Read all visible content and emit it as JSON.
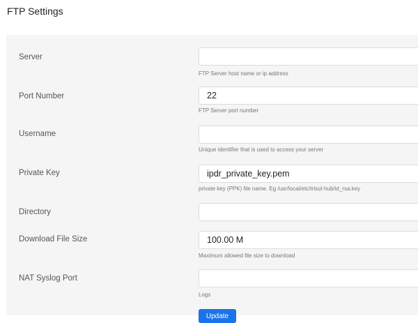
{
  "page": {
    "title": "FTP Settings"
  },
  "form": {
    "fields": [
      {
        "label": "Server",
        "value": "",
        "help": "FTP Server host name or ip address"
      },
      {
        "label": "Port Number",
        "value": "22",
        "help": "FTP Server port number"
      },
      {
        "label": "Username",
        "value": "",
        "help": "Unique identifier that is used to access your server"
      },
      {
        "label": "Private Key",
        "value": "ipdr_private_key.pem",
        "help": "private key (PPK) file name. Eg /usr/local/etc/trisul-hub/id_rsa.key"
      },
      {
        "label": "Directory",
        "value": "",
        "help": ""
      },
      {
        "label": "Download File Size",
        "value": "100.00 M",
        "help": "Maximum allowed file size to download"
      },
      {
        "label": "NAT Syslog Port",
        "value": "",
        "help": "Logs"
      }
    ],
    "submit_label": "Update"
  }
}
